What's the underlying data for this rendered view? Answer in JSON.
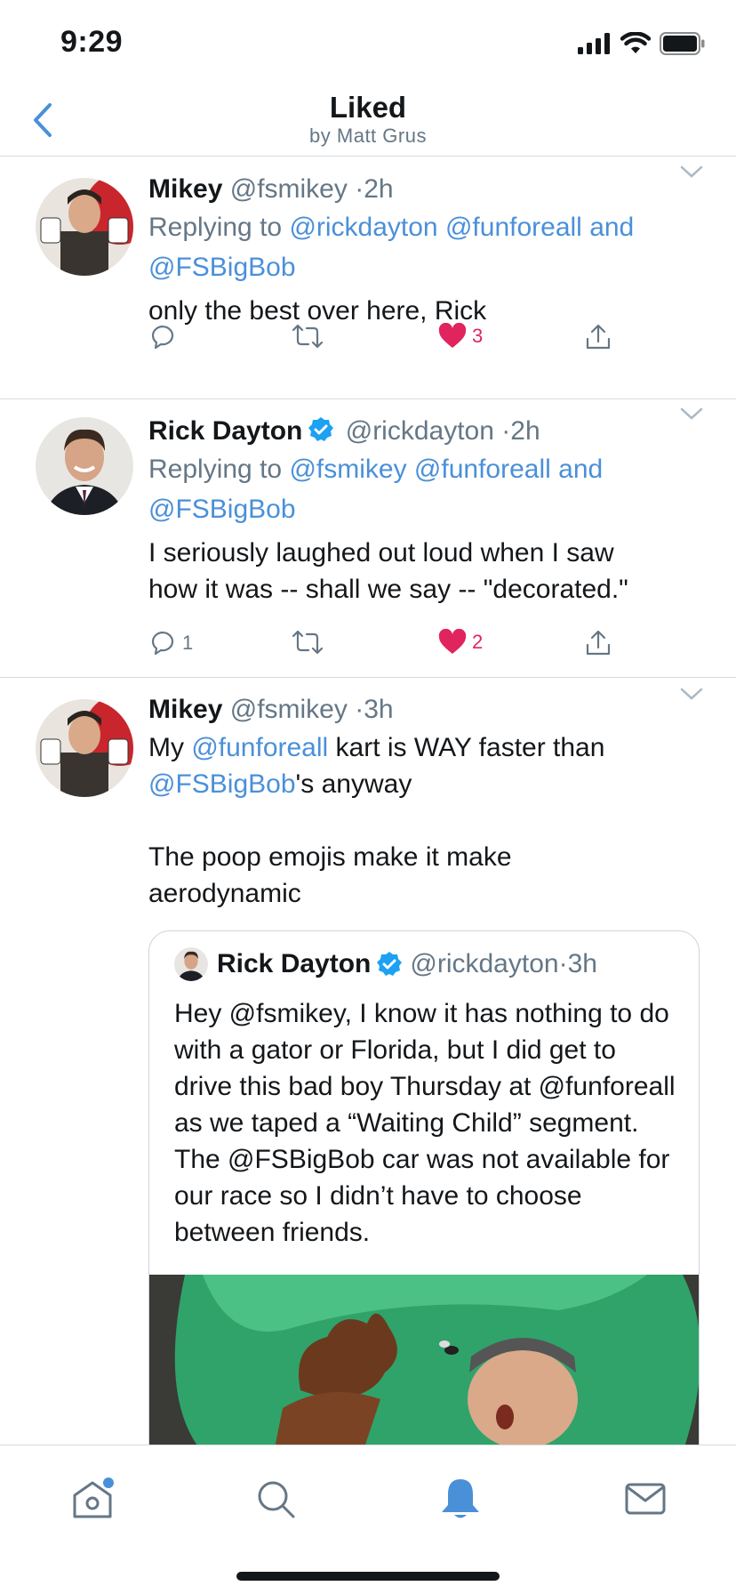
{
  "status_bar": {
    "time": "9:29"
  },
  "nav": {
    "title": "Liked",
    "subtitle": "by Matt Grus"
  },
  "tweets": [
    {
      "name": "Mikey",
      "handle": "@fsmikey",
      "time": "2h",
      "reply_prefix": "Replying to",
      "reply_mentions": [
        "@rickdayton",
        "@funforeall",
        "and",
        "@FSBigBob"
      ],
      "text": "only the best over here, Rick",
      "reply_count": "",
      "like_count": "3",
      "liked": true
    },
    {
      "name": "Rick Dayton",
      "handle": "@rickdayton",
      "time": "2h",
      "verified": true,
      "reply_prefix": "Replying to",
      "reply_mentions": [
        "@fsmikey",
        "@funforeall",
        "and",
        "@FSBigBob"
      ],
      "text_line1": "I seriously laughed out loud when I saw",
      "text_line2": "how it was -- shall we say -- \"decorated.\"",
      "reply_count": "1",
      "like_count": "2",
      "liked": true
    },
    {
      "name": "Mikey",
      "handle": "@fsmikey",
      "time": "3h",
      "text_a": "My ",
      "mention_a": "@funforeall",
      "text_b": " kart is WAY faster than",
      "mention_b": "@FSBigBob",
      "text_c": "'s anyway",
      "text_d": "The poop emojis make it make",
      "text_e": "aerodynamic",
      "quote": {
        "name": "Rick Dayton",
        "handle": "@rickdayton",
        "time": "3h",
        "verified": true,
        "text": "Hey @fsmikey, I know it has nothing to do with a gator or  Florida, but I did get to drive this bad boy Thursday at @funforeall as we taped a “Waiting Child” segment. The @FSBigBob car was not available for our race so I didn’t have to choose between friends."
      }
    }
  ],
  "tab_bar": {
    "items": [
      "home-icon",
      "search-icon",
      "notifications-icon",
      "messages-icon"
    ],
    "active": "notifications-icon"
  },
  "colors": {
    "accent": "#4a90d9",
    "like": "#e0245e",
    "text": "#14171a",
    "secondary": "#657786",
    "verified": "#1da1f2"
  }
}
